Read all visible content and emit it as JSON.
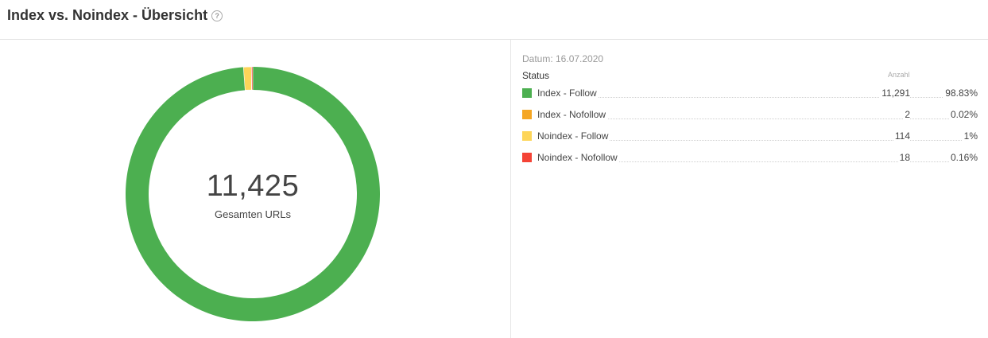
{
  "header": {
    "title": "Index vs. Noindex - Übersicht",
    "help_icon": "question-circle-icon"
  },
  "summary": {
    "total": "11,425",
    "total_label": "Gesamten URLs"
  },
  "legend": {
    "date": "Datum: 16.07.2020",
    "status_header": "Status",
    "count_header": "Anzahl",
    "rows": [
      {
        "label": "Index - Follow",
        "count": "11,291",
        "percent": "98.83%",
        "color": "#4caf50"
      },
      {
        "label": "Index - Nofollow",
        "count": "2",
        "percent": "0.02%",
        "color": "#f5a623"
      },
      {
        "label": "Noindex - Follow",
        "count": "114",
        "percent": "1%",
        "color": "#fdd559"
      },
      {
        "label": "Noindex - Nofollow",
        "count": "18",
        "percent": "0.16%",
        "color": "#f44336"
      }
    ]
  },
  "chart_data": {
    "type": "pie",
    "style": "donut",
    "categories": [
      "Index - Follow",
      "Index - Nofollow",
      "Noindex - Follow",
      "Noindex - Nofollow"
    ],
    "values": [
      11291,
      2,
      114,
      18
    ],
    "colors": [
      "#4caf50",
      "#f5a623",
      "#fdd559",
      "#f44336"
    ],
    "title": "",
    "center_value": "11,425",
    "center_label": "Gesamten URLs",
    "legend": "right"
  }
}
